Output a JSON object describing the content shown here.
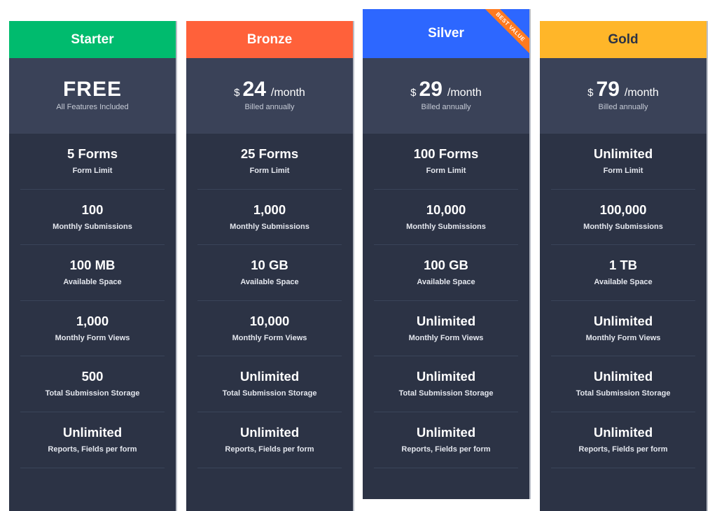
{
  "plans": [
    {
      "name": "Starter",
      "header_color": "#00bb6e",
      "header_text_color": "#ffffff",
      "price_display": "FREE",
      "price_subtext": "All Features Included",
      "features": [
        {
          "value": "5 Forms",
          "label": "Form Limit"
        },
        {
          "value": "100",
          "label": "Monthly Submissions"
        },
        {
          "value": "100 MB",
          "label": "Available Space"
        },
        {
          "value": "1,000",
          "label": "Monthly Form Views"
        },
        {
          "value": "500",
          "label": "Total Submission Storage"
        },
        {
          "value": "Unlimited",
          "label": "Reports, Fields per form"
        }
      ]
    },
    {
      "name": "Bronze",
      "header_color": "#ff613a",
      "header_text_color": "#ffffff",
      "currency": "$",
      "amount": "24",
      "period": "/month",
      "price_subtext": "Billed annually",
      "features": [
        {
          "value": "25 Forms",
          "label": "Form Limit"
        },
        {
          "value": "1,000",
          "label": "Monthly Submissions"
        },
        {
          "value": "10 GB",
          "label": "Available Space"
        },
        {
          "value": "10,000",
          "label": "Monthly Form Views"
        },
        {
          "value": "Unlimited",
          "label": "Total Submission Storage"
        },
        {
          "value": "Unlimited",
          "label": "Reports, Fields per form"
        }
      ]
    },
    {
      "name": "Silver",
      "header_color": "#2d67ff",
      "header_text_color": "#ffffff",
      "currency": "$",
      "amount": "29",
      "period": "/month",
      "price_subtext": "Billed annually",
      "badge": "BEST VALUE",
      "badge_color": "#ff7a1f",
      "features": [
        {
          "value": "100 Forms",
          "label": "Form Limit"
        },
        {
          "value": "10,000",
          "label": "Monthly Submissions"
        },
        {
          "value": "100 GB",
          "label": "Available Space"
        },
        {
          "value": "Unlimited",
          "label": "Monthly Form Views"
        },
        {
          "value": "Unlimited",
          "label": "Total Submission Storage"
        },
        {
          "value": "Unlimited",
          "label": "Reports, Fields per form"
        }
      ]
    },
    {
      "name": "Gold",
      "header_color": "#ffb629",
      "header_text_color": "#2c3345",
      "currency": "$",
      "amount": "79",
      "period": "/month",
      "price_subtext": "Billed annually",
      "features": [
        {
          "value": "Unlimited",
          "label": "Form Limit"
        },
        {
          "value": "100,000",
          "label": "Monthly Submissions"
        },
        {
          "value": "1 TB",
          "label": "Available Space"
        },
        {
          "value": "Unlimited",
          "label": "Monthly Form Views"
        },
        {
          "value": "Unlimited",
          "label": "Total Submission Storage"
        },
        {
          "value": "Unlimited",
          "label": "Reports, Fields per form"
        }
      ]
    }
  ]
}
